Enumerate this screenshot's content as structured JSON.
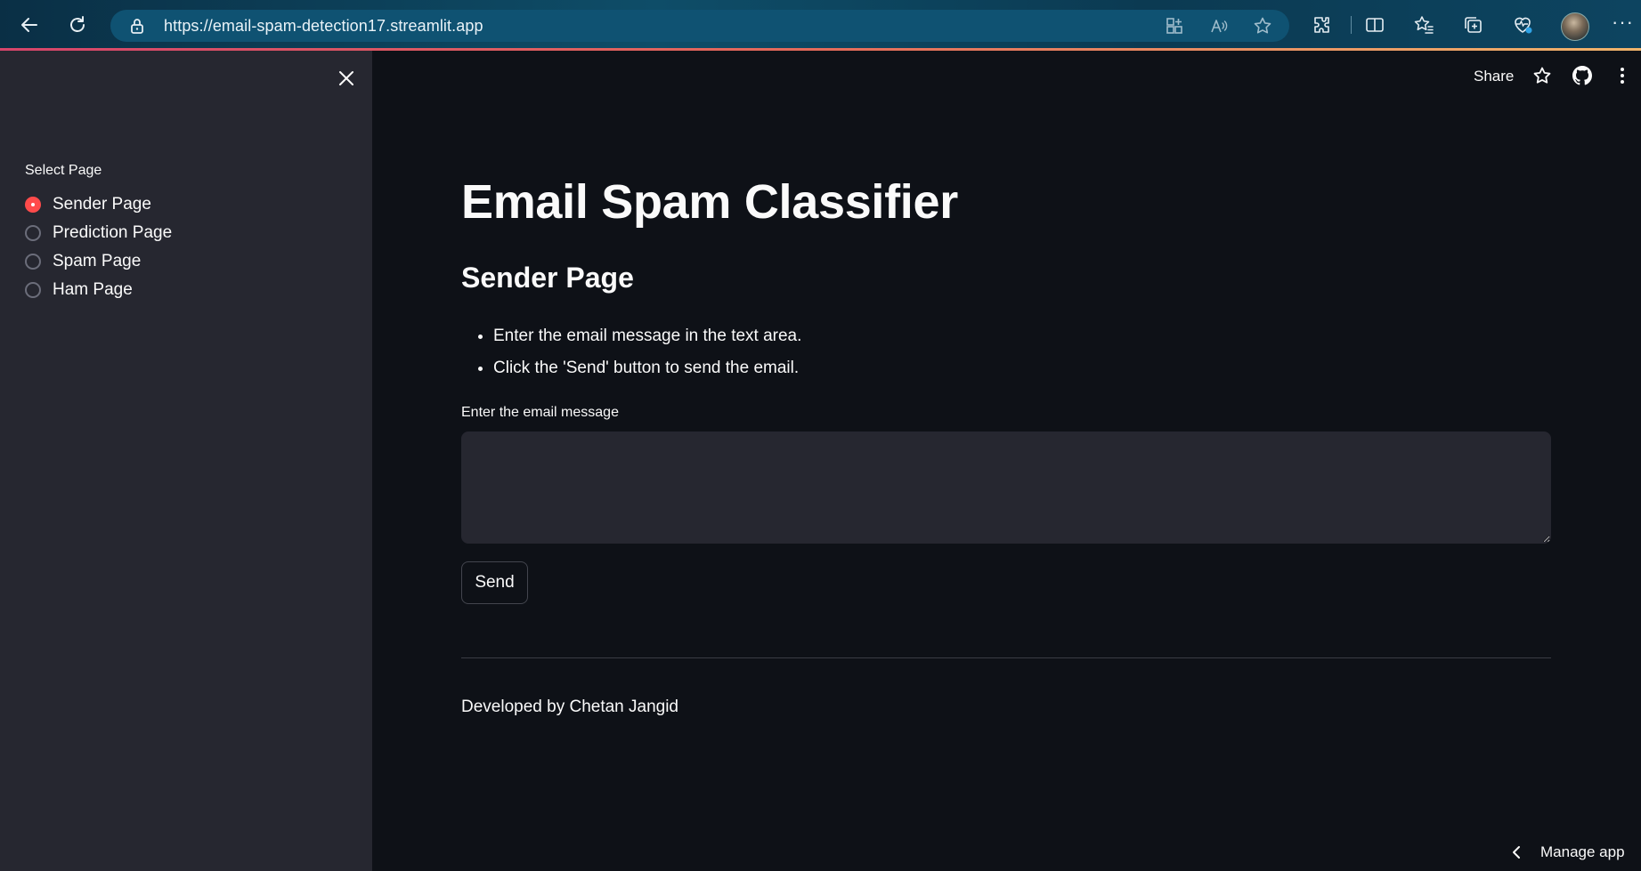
{
  "browser": {
    "url": "https://email-spam-detection17.streamlit.app",
    "back_icon": "back-arrow-icon",
    "refresh_icon": "refresh-icon"
  },
  "sidebar": {
    "label": "Select Page",
    "options": [
      {
        "label": "Sender Page",
        "selected": true
      },
      {
        "label": "Prediction Page",
        "selected": false
      },
      {
        "label": "Spam Page",
        "selected": false
      },
      {
        "label": "Ham Page",
        "selected": false
      }
    ]
  },
  "toolbar": {
    "share_label": "Share"
  },
  "main": {
    "title": "Email Spam Classifier",
    "subtitle": "Sender Page",
    "instructions": [
      "Enter the email message in the text area.",
      "Click the 'Send' button to send the email."
    ],
    "message_label": "Enter the email message",
    "message_value": "",
    "send_label": "Send",
    "footer": "Developed by Chetan Jangid"
  },
  "manage_app": {
    "label": "Manage app"
  },
  "colors": {
    "background": "#0e1117",
    "sidebar": "#262730",
    "accent": "#ff4b4b",
    "browser_bar": "#0b3a52"
  }
}
